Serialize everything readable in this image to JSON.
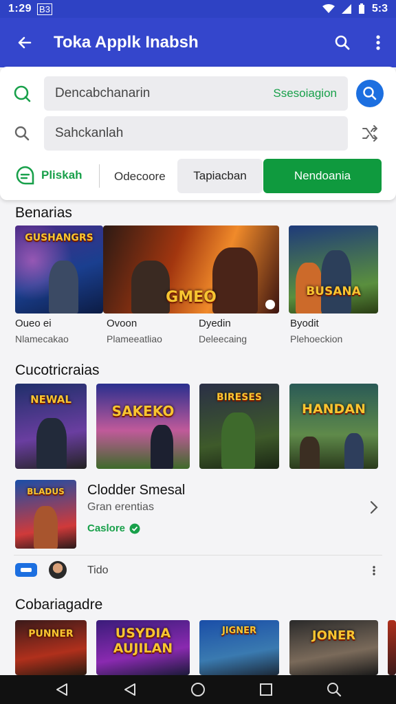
{
  "status_bar": {
    "time": "1:29",
    "badge": "B3",
    "battery_text": "5:3"
  },
  "app_bar": {
    "title": "Toka Applk Inabsh"
  },
  "search_card": {
    "field1": {
      "value": "Dencabchanarin",
      "suggestion": "Ssesoiagion"
    },
    "field2": {
      "value": "Sahckanlah"
    },
    "chips": {
      "pliskah": "Pliskah",
      "odecoore": "Odecoore",
      "tapiacban": "Tapiacban",
      "nendoania": "Nendoania"
    }
  },
  "section1": {
    "title": "Benarias",
    "items": [
      {
        "art": "GUSHANGRS",
        "name": "Oueo ei",
        "sub": "Nlamecakao"
      },
      {
        "art": "GMEO",
        "name": "Ovoon",
        "sub": "Plameeatliao"
      },
      {
        "art": "",
        "name": "Dyedin",
        "sub": "Deleecaing"
      },
      {
        "art": "BUSANA",
        "name": "Byodit",
        "sub": "Plehoeckion"
      }
    ]
  },
  "section2": {
    "title": "Cucotricraias",
    "items": [
      {
        "art": "NEWAL"
      },
      {
        "art": "SAKEKO"
      },
      {
        "art": "BIRESES"
      },
      {
        "art": "HANDAN"
      }
    ],
    "feature": {
      "art": "BLADUS",
      "title": "Clodder Smesal",
      "subtitle": "Gran erentias",
      "status": "Caslore"
    },
    "meta_text": "Tido"
  },
  "section3": {
    "title": "Cobariagadre",
    "items": [
      {
        "art": "PUNNER"
      },
      {
        "art": "USYDIA AUJILAN"
      },
      {
        "art": "JIGNER"
      },
      {
        "art": "JONER"
      }
    ]
  },
  "colors": {
    "app_bar": "#3446cc",
    "status_bar": "#2e42c4",
    "accent_green": "#0f9a3e",
    "accent_blue": "#1c6fe0"
  },
  "icons": [
    "back-arrow-icon",
    "search-icon",
    "more-vert-icon",
    "refresh-search-icon",
    "magnifier-icon",
    "shuffle-icon",
    "message-icon",
    "verified-icon",
    "chevron-right-icon",
    "nav-back-icon",
    "nav-home-icon",
    "nav-recents-icon"
  ]
}
